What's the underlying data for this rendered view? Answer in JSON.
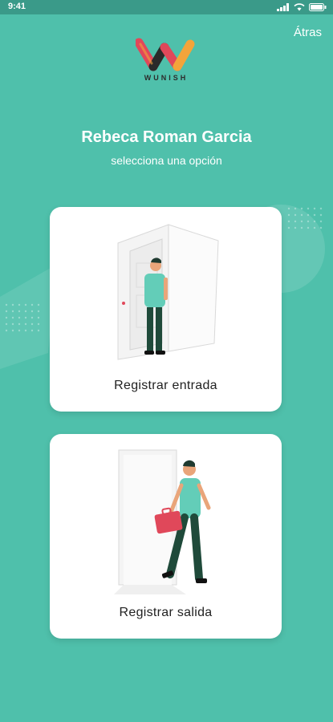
{
  "status_bar": {
    "time": "9:41"
  },
  "header": {
    "back_label": "Átras"
  },
  "logo": {
    "text": "WUNISH"
  },
  "greeting": {
    "name": "Rebeca Roman Garcia",
    "subtitle": "selecciona una opción"
  },
  "options": [
    {
      "label": "Registrar entrada",
      "icon": "person-entering-door-illustration"
    },
    {
      "label": "Registrar salida",
      "icon": "person-leaving-with-briefcase-illustration"
    }
  ],
  "colors": {
    "background": "#4fc0ab",
    "card": "#ffffff",
    "logo_red": "#e0485a",
    "logo_orange": "#f3a43a",
    "briefcase": "#e0485a",
    "figure_pants": "#1f4a3a"
  }
}
